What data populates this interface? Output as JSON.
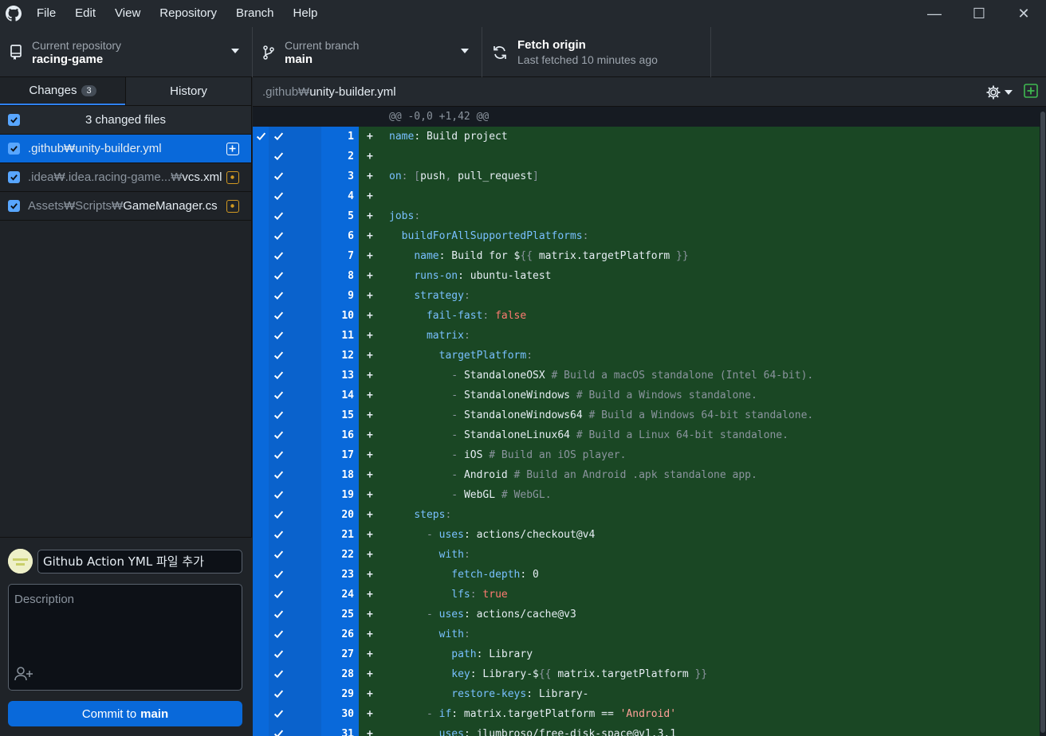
{
  "menu": [
    "File",
    "Edit",
    "View",
    "Repository",
    "Branch",
    "Help"
  ],
  "toolbar": {
    "repo_label": "Current repository",
    "repo_value": "racing-game",
    "branch_label": "Current branch",
    "branch_value": "main",
    "fetch_label": "Fetch origin",
    "fetch_sub": "Last fetched 10 minutes ago"
  },
  "sidebar": {
    "tab_changes": "Changes",
    "tab_changes_count": "3",
    "tab_history": "History",
    "changed_files": "3 changed files",
    "files": [
      {
        "dir": ".github₩",
        "name": "unity-builder.yml",
        "status": "added"
      },
      {
        "dir": ".idea₩.idea.racing-game...₩",
        "name": "vcs.xml",
        "status": "modified"
      },
      {
        "dir": "Assets₩Scripts₩",
        "name": "GameManager.cs",
        "status": "modified"
      }
    ],
    "summary": "Github Action YML 파일 추가",
    "description_placeholder": "Description",
    "commit_prefix": "Commit to",
    "commit_branch": "main"
  },
  "diff": {
    "path_dir": ".github₩",
    "path_file": "unity-builder.yml",
    "hunk": "@@ -0,0 +1,42 @@",
    "lines": [
      {
        "n": "1",
        "t": [
          [
            "k",
            "name"
          ],
          [
            "s",
            ": Build project"
          ]
        ]
      },
      {
        "n": "2",
        "t": []
      },
      {
        "n": "3",
        "t": [
          [
            "k",
            "on"
          ],
          [
            "c",
            ": ["
          ],
          [
            "s",
            "push"
          ],
          [
            "c",
            ", "
          ],
          [
            "s",
            "pull_request"
          ],
          [
            "c",
            "]"
          ]
        ]
      },
      {
        "n": "4",
        "t": []
      },
      {
        "n": "5",
        "t": [
          [
            "k",
            "jobs"
          ],
          [
            "c",
            ":"
          ]
        ]
      },
      {
        "n": "6",
        "t": [
          [
            "s",
            "  "
          ],
          [
            "k",
            "buildForAllSupportedPlatforms"
          ],
          [
            "c",
            ":"
          ]
        ]
      },
      {
        "n": "7",
        "t": [
          [
            "s",
            "    "
          ],
          [
            "k",
            "name"
          ],
          [
            "s",
            ": Build for $"
          ],
          [
            "c",
            "{{"
          ],
          [
            "s",
            " matrix.targetPlatform "
          ],
          [
            "c",
            "}}"
          ]
        ]
      },
      {
        "n": "8",
        "t": [
          [
            "s",
            "    "
          ],
          [
            "k",
            "runs-on"
          ],
          [
            "s",
            ": ubuntu-latest"
          ]
        ]
      },
      {
        "n": "9",
        "t": [
          [
            "s",
            "    "
          ],
          [
            "k",
            "strategy"
          ],
          [
            "c",
            ":"
          ]
        ]
      },
      {
        "n": "10",
        "t": [
          [
            "s",
            "      "
          ],
          [
            "k",
            "fail-fast"
          ],
          [
            "c",
            ": "
          ],
          [
            "b",
            "false"
          ]
        ]
      },
      {
        "n": "11",
        "t": [
          [
            "s",
            "      "
          ],
          [
            "k",
            "matrix"
          ],
          [
            "c",
            ":"
          ]
        ]
      },
      {
        "n": "12",
        "t": [
          [
            "s",
            "        "
          ],
          [
            "k",
            "targetPlatform"
          ],
          [
            "c",
            ":"
          ]
        ]
      },
      {
        "n": "13",
        "t": [
          [
            "s",
            "          "
          ],
          [
            "c",
            "- "
          ],
          [
            "s",
            "StandaloneOSX"
          ],
          [
            "c",
            " # Build a macOS standalone (Intel 64-bit)."
          ]
        ]
      },
      {
        "n": "14",
        "t": [
          [
            "s",
            "          "
          ],
          [
            "c",
            "- "
          ],
          [
            "s",
            "StandaloneWindows"
          ],
          [
            "c",
            " # Build a Windows standalone."
          ]
        ]
      },
      {
        "n": "15",
        "t": [
          [
            "s",
            "          "
          ],
          [
            "c",
            "- "
          ],
          [
            "s",
            "StandaloneWindows64"
          ],
          [
            "c",
            " # Build a Windows 64-bit standalone."
          ]
        ]
      },
      {
        "n": "16",
        "t": [
          [
            "s",
            "          "
          ],
          [
            "c",
            "- "
          ],
          [
            "s",
            "StandaloneLinux64"
          ],
          [
            "c",
            " # Build a Linux 64-bit standalone."
          ]
        ]
      },
      {
        "n": "17",
        "t": [
          [
            "s",
            "          "
          ],
          [
            "c",
            "- "
          ],
          [
            "s",
            "iOS"
          ],
          [
            "c",
            " # Build an iOS player."
          ]
        ]
      },
      {
        "n": "18",
        "t": [
          [
            "s",
            "          "
          ],
          [
            "c",
            "- "
          ],
          [
            "s",
            "Android"
          ],
          [
            "c",
            " # Build an Android .apk standalone app."
          ]
        ]
      },
      {
        "n": "19",
        "t": [
          [
            "s",
            "          "
          ],
          [
            "c",
            "- "
          ],
          [
            "s",
            "WebGL"
          ],
          [
            "c",
            " # WebGL."
          ]
        ]
      },
      {
        "n": "20",
        "t": [
          [
            "s",
            "    "
          ],
          [
            "k",
            "steps"
          ],
          [
            "c",
            ":"
          ]
        ]
      },
      {
        "n": "21",
        "t": [
          [
            "s",
            "      "
          ],
          [
            "c",
            "- "
          ],
          [
            "k",
            "uses"
          ],
          [
            "s",
            ": actions/checkout@v4"
          ]
        ]
      },
      {
        "n": "22",
        "t": [
          [
            "s",
            "        "
          ],
          [
            "k",
            "with"
          ],
          [
            "c",
            ":"
          ]
        ]
      },
      {
        "n": "23",
        "t": [
          [
            "s",
            "          "
          ],
          [
            "k",
            "fetch-depth"
          ],
          [
            "s",
            ": 0"
          ]
        ]
      },
      {
        "n": "24",
        "t": [
          [
            "s",
            "          "
          ],
          [
            "k",
            "lfs"
          ],
          [
            "c",
            ": "
          ],
          [
            "b",
            "true"
          ]
        ]
      },
      {
        "n": "25",
        "t": [
          [
            "s",
            "      "
          ],
          [
            "c",
            "- "
          ],
          [
            "k",
            "uses"
          ],
          [
            "s",
            ": actions/cache@v3"
          ]
        ]
      },
      {
        "n": "26",
        "t": [
          [
            "s",
            "        "
          ],
          [
            "k",
            "with"
          ],
          [
            "c",
            ":"
          ]
        ]
      },
      {
        "n": "27",
        "t": [
          [
            "s",
            "          "
          ],
          [
            "k",
            "path"
          ],
          [
            "s",
            ": Library"
          ]
        ]
      },
      {
        "n": "28",
        "t": [
          [
            "s",
            "          "
          ],
          [
            "k",
            "key"
          ],
          [
            "s",
            ": Library-$"
          ],
          [
            "c",
            "{{"
          ],
          [
            "s",
            " matrix.targetPlatform "
          ],
          [
            "c",
            "}}"
          ]
        ]
      },
      {
        "n": "29",
        "t": [
          [
            "s",
            "          "
          ],
          [
            "k",
            "restore-keys"
          ],
          [
            "s",
            ": Library-"
          ]
        ]
      },
      {
        "n": "30",
        "t": [
          [
            "s",
            "      "
          ],
          [
            "c",
            "- "
          ],
          [
            "k",
            "if"
          ],
          [
            "s",
            ": matrix.targetPlatform == "
          ],
          [
            "q",
            "'Android'"
          ]
        ]
      },
      {
        "n": "31",
        "t": [
          [
            "s",
            "        "
          ],
          [
            "k",
            "uses"
          ],
          [
            "s",
            ": jlumbroso/free-disk-space@v1.3.1"
          ]
        ]
      }
    ]
  }
}
